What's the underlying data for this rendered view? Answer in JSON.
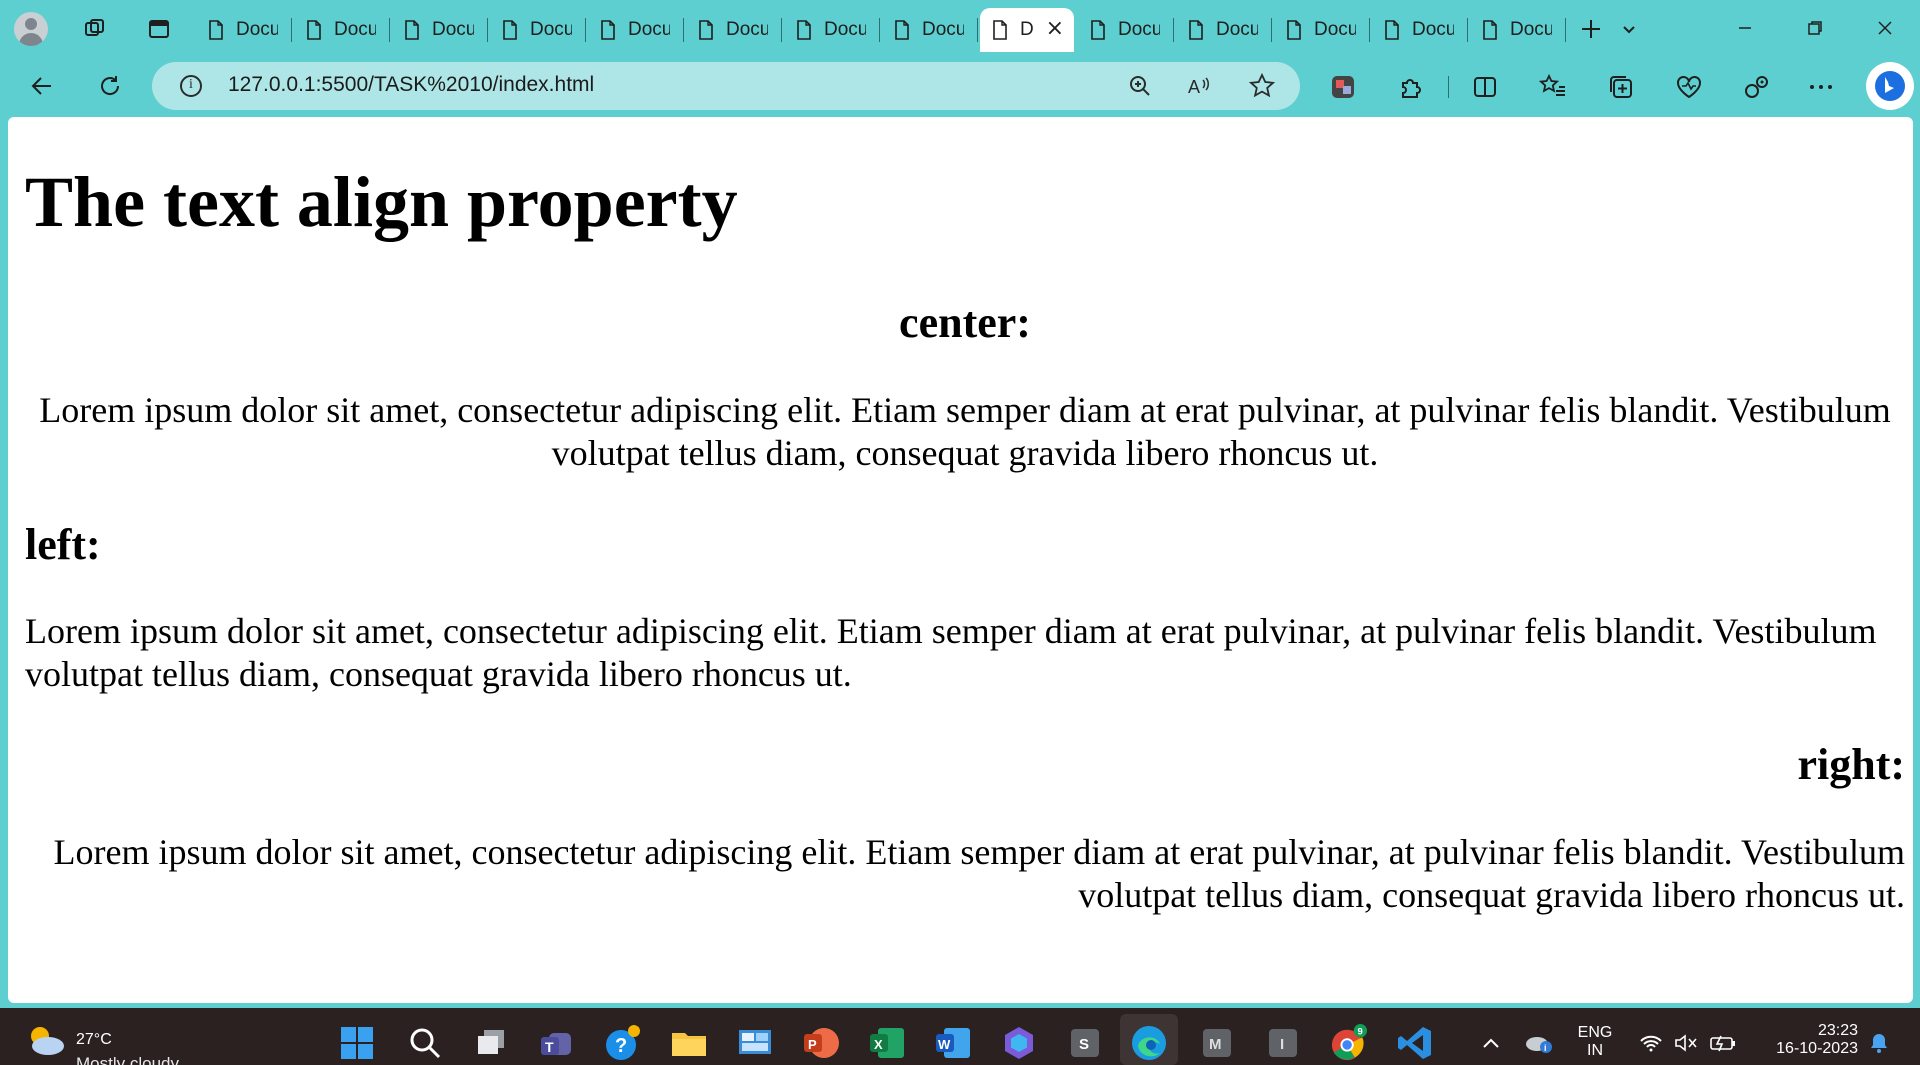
{
  "browser": {
    "tabs": [
      {
        "label": "Docu"
      },
      {
        "label": "Docu"
      },
      {
        "label": "Docu"
      },
      {
        "label": "Docu"
      },
      {
        "label": "Docu"
      },
      {
        "label": "Docu"
      },
      {
        "label": "Docu"
      },
      {
        "label": "Docu"
      },
      {
        "label": "D",
        "active": true
      },
      {
        "label": "Docu"
      },
      {
        "label": "Docu"
      },
      {
        "label": "Docu"
      },
      {
        "label": "Docu"
      },
      {
        "label": "Docu"
      }
    ],
    "active_tab_close": "×",
    "address": "127.0.0.1:5500/TASK%2010/index.html"
  },
  "page": {
    "title": "The text align property",
    "sections": [
      {
        "heading": "center:",
        "align": "center",
        "text": "Lorem ipsum dolor sit amet, consectetur adipiscing elit. Etiam semper diam at erat pulvinar, at pulvinar felis blandit. Vestibulum volutpat tellus diam, consequat gravida libero rhoncus ut."
      },
      {
        "heading": "left:",
        "align": "left",
        "text": "Lorem ipsum dolor sit amet, consectetur adipiscing elit. Etiam semper diam at erat pulvinar, at pulvinar felis blandit. Vestibulum volutpat tellus diam, consequat gravida libero rhoncus ut."
      },
      {
        "heading": "right:",
        "align": "right",
        "text": "Lorem ipsum dolor sit amet, consectetur adipiscing elit. Etiam semper diam at erat pulvinar, at pulvinar felis blandit. Vestibulum volutpat tellus diam, consequat gravida libero rhoncus ut."
      }
    ]
  },
  "taskbar": {
    "weather_temp": "27°C",
    "weather_condition": "Mostly cloudy",
    "language_line1": "ENG",
    "language_line2": "IN",
    "time": "23:23",
    "date": "16-10-2023",
    "chrome_badge": "9"
  },
  "colors": {
    "browser_frame": "#5dcfd0",
    "address_bar": "#aee6e7",
    "taskbar": "#2b2121",
    "page_bg": "#ffffff"
  },
  "icons": {
    "tabstrip": [
      "profile-avatar-icon",
      "workspaces-icon",
      "tab-actions-icon",
      "document-icon",
      "close-icon",
      "new-tab-plus-icon",
      "tab-list-chevron-icon",
      "minimize-icon",
      "restore-icon",
      "window-close-icon"
    ],
    "navbar": [
      "back-arrow-icon",
      "refresh-icon",
      "site-info-icon",
      "zoom-icon",
      "read-aloud-icon",
      "favorite-star-icon",
      "extension-app-icon",
      "extensions-puzzle-icon",
      "split-screen-icon",
      "favorites-list-icon",
      "collections-icon",
      "browser-essentials-icon",
      "copilot-tools-icon",
      "more-dots-icon",
      "bing-chat-icon"
    ]
  }
}
